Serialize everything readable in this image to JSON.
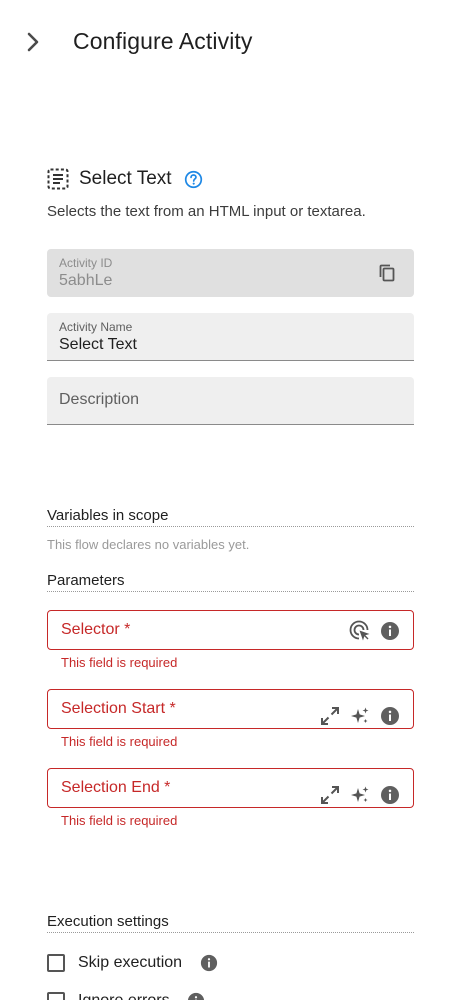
{
  "header": {
    "title": "Configure Activity",
    "collapse_icon": "chevron-right-icon"
  },
  "activity": {
    "icon": "select-text-icon",
    "title": "Select Text",
    "help_icon": "help-circle-icon",
    "description": "Selects the text from an HTML input or textarea."
  },
  "fields": {
    "activity_id": {
      "label": "Activity ID",
      "value": "5abhLe",
      "icon": "copy-icon"
    },
    "activity_name": {
      "label": "Activity Name",
      "value": "Select Text"
    },
    "description": {
      "placeholder": "Description"
    }
  },
  "variables": {
    "title": "Variables in scope",
    "note": "This flow declares no variables yet."
  },
  "parameters": {
    "title": "Parameters",
    "items": [
      {
        "label": "Selector *",
        "error": "This field is required",
        "icons": [
          "target-picker-icon",
          "info-icon"
        ]
      },
      {
        "label": "Selection Start *",
        "error": "This field is required",
        "icons": [
          "expand-icon",
          "sparkle-icon",
          "info-icon"
        ]
      },
      {
        "label": "Selection End *",
        "error": "This field is required",
        "icons": [
          "expand-icon",
          "sparkle-icon",
          "info-icon"
        ]
      }
    ]
  },
  "execution": {
    "title": "Execution settings",
    "items": [
      {
        "label": "Skip execution",
        "checked": false,
        "icon": "info-icon"
      },
      {
        "label": "Ignore errors",
        "checked": false,
        "icon": "info-icon"
      }
    ]
  },
  "colors": {
    "error": "#c62828",
    "accent": "#1e88e5",
    "field_bg": "#efefef",
    "disabled_bg": "#e0e0e0"
  }
}
